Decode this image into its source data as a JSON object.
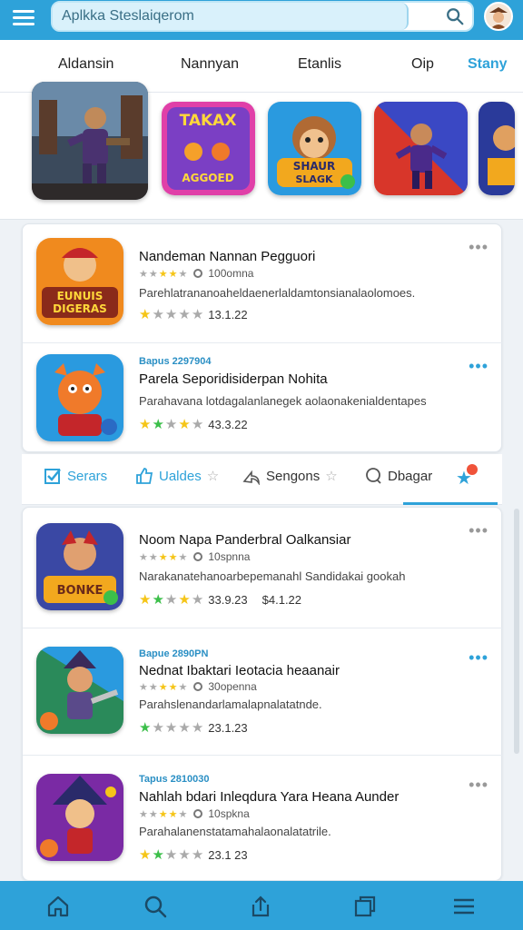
{
  "search": {
    "value": "Aplkka Steslaiqerom"
  },
  "tabs": [
    {
      "label": "Aldansin"
    },
    {
      "label": "Nannyan"
    },
    {
      "label": "Etanlis"
    },
    {
      "label": "Oip"
    },
    {
      "label": "Stany",
      "active": true
    }
  ],
  "featured": [
    {
      "label": ""
    },
    {
      "label": "TAKAX",
      "sub": "AGGOED"
    },
    {
      "label": "SHAUR",
      "sub": "SLAGK"
    },
    {
      "label": ""
    },
    {
      "label": ""
    }
  ],
  "list1": [
    {
      "icon_text": "EUNUIS DIGERAS",
      "title": "Nandeman Nannan Pegguori",
      "downloads": "100omna",
      "desc": "Parehlatrananoaheldaenerlaldamtonsianalaolomoes.",
      "rating": "13.1.22"
    },
    {
      "tag": "Bapus 2297904",
      "title": "Parela Seporidisiderpan Nohita",
      "desc": "Parahavana lotdagalanlanegek aolaonakenialdentapes",
      "rating": "43.3.22"
    }
  ],
  "actions": [
    {
      "label": "Serars"
    },
    {
      "label": "Ualdes"
    },
    {
      "label": "Sengons"
    },
    {
      "label": "Dbagar"
    }
  ],
  "list2": [
    {
      "icon_text": "BONKE",
      "title": "Noom Napa Panderbral Oalkansiar",
      "downloads": "10spnna",
      "desc": "Narakanatehanoarbepemanahl Sandidakai gookah",
      "rating": "33.9.23",
      "rating2": "$4.1.22"
    },
    {
      "tag": "Bapue 2890PN",
      "title": "Nednat Ibaktari Ieotacia heaanair",
      "downloads": "30openna",
      "desc": "Parahslenandarlamalapnalatatnde.",
      "rating": "23.1.23"
    },
    {
      "tag": "Tapus 2810030",
      "title": "Nahlah bdari Inleqdura Yara Heana Aunder",
      "downloads": "10spkna",
      "desc": "Parahalanenstatamahalaonalatatrile.",
      "rating": "23.1 23"
    }
  ],
  "colors": {
    "accent": "#2ea2d9",
    "star": "#f5c518",
    "star_green": "#3cbf4a"
  }
}
